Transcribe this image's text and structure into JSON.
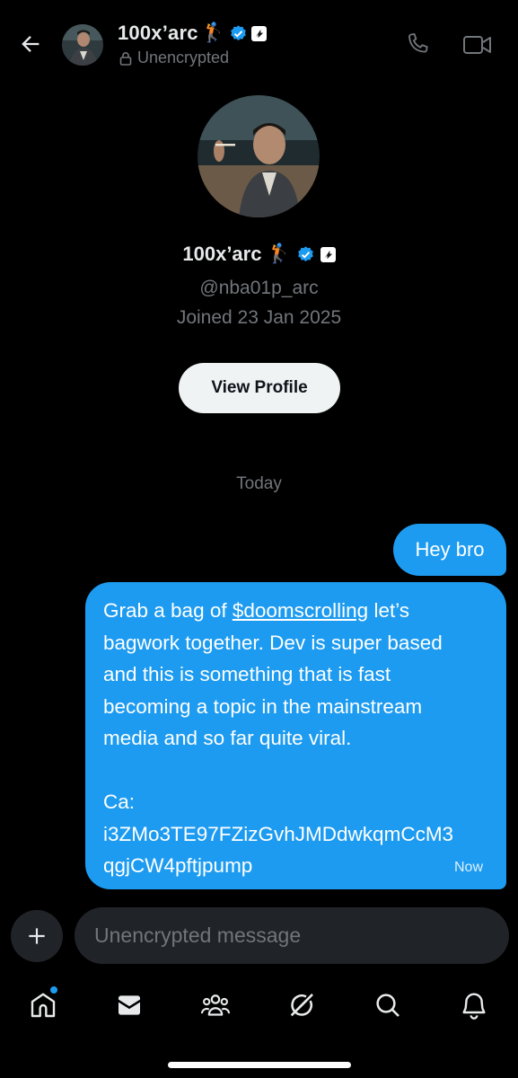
{
  "header": {
    "name": "100x’arc",
    "emoji": "🏌",
    "status": "Unencrypted"
  },
  "profile": {
    "name": "100x’arc",
    "emoji": "🏌",
    "handle": "@nba01p_arc",
    "joined": "Joined 23 Jan 2025",
    "view_profile_label": "View Profile"
  },
  "conversation": {
    "date_divider": "Today",
    "messages": [
      {
        "text": "Hey bro"
      },
      {
        "line1_pre": "Grab a bag of ",
        "line1_link": "$doomscrolling",
        "line1_post": " let’s",
        "line2": "bagwork together. Dev is super based",
        "line3": "and this is something that is fast",
        "line4": "becoming a topic in the mainstream",
        "line5": "media and so far quite viral.",
        "line6": "Ca:",
        "line7": "i3ZMo3TE97FZizGvhJMDdwkqmCcM3",
        "line8": "qgjCW4pftjpump",
        "time": "Now"
      }
    ]
  },
  "composer": {
    "placeholder": "Unencrypted message"
  },
  "icons": {
    "back": "arrow-left-icon",
    "call": "phone-icon",
    "video": "video-camera-icon",
    "lock": "lock-icon",
    "verified": "verified-badge-icon",
    "affiliate": "affiliate-badge-icon",
    "plus": "plus-icon",
    "nav": [
      "home-icon",
      "messages-icon",
      "communities-icon",
      "grok-icon",
      "search-icon",
      "notifications-icon"
    ]
  },
  "colors": {
    "accent": "#1d9bf0",
    "background": "#000000",
    "muted": "#71767b"
  }
}
